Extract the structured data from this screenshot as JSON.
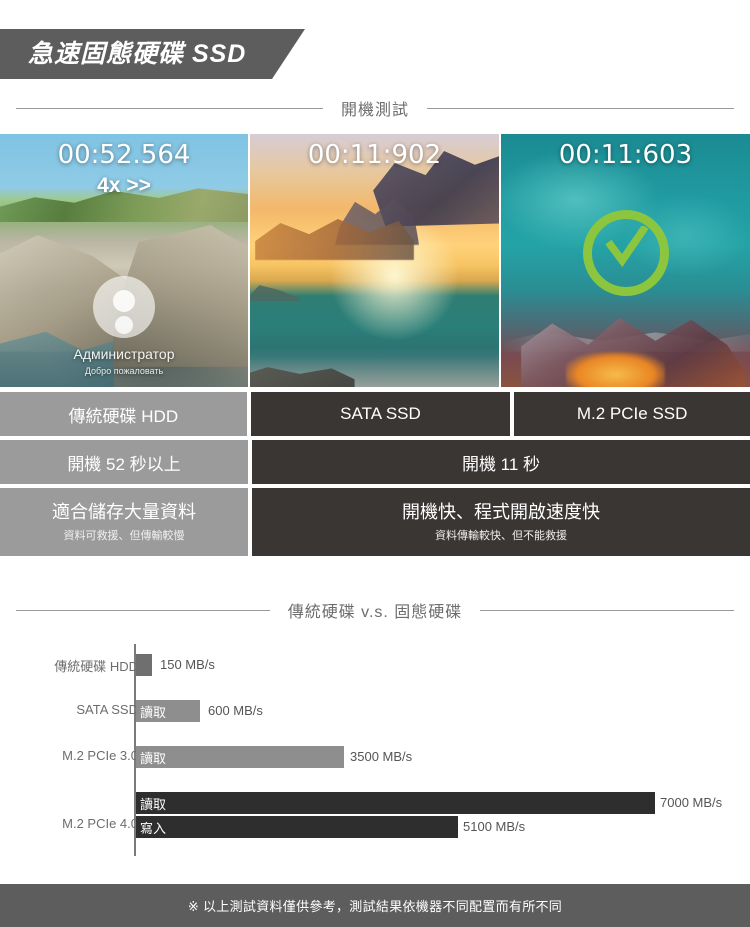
{
  "header": {
    "banner_title": "急速固態硬碟 SSD"
  },
  "sections": {
    "boot_test_title": "開機測試",
    "comparison_title": "傳統硬碟 v.s. 固態硬碟"
  },
  "boot_panels": [
    {
      "timer": "00:52.564",
      "speed_tag": "4x >>",
      "user_name": "Администратор",
      "welcome": "Добро пожаловать",
      "scene": "rocky-coast-windows-logon"
    },
    {
      "timer": "00:11:902",
      "speed_tag": "",
      "scene": "sunset-ocean"
    },
    {
      "timer": "00:11:603",
      "speed_tag": "",
      "scene": "teal-water-check",
      "check_color": "#8cc63f"
    }
  ],
  "table": {
    "row_headers": [
      "傳統硬碟 HDD",
      "SATA SSD",
      "M.2 PCIe SSD"
    ],
    "row_boot": [
      "開機 52 秒以上",
      "開機 11 秒"
    ],
    "row_traits": [
      {
        "main": "適合儲存大量資料",
        "sub": "資料可救援、但傳輸較慢"
      },
      {
        "main": "開機快、程式開啟速度快",
        "sub": "資料傳輸較快、但不能救援"
      }
    ]
  },
  "chart_data": {
    "type": "bar",
    "title": "傳統硬碟 v.s. 固態硬碟",
    "xlabel": "",
    "ylabel": "",
    "unit": "MB/s",
    "orientation": "horizontal",
    "xlim": [
      0,
      7000
    ],
    "grid": false,
    "legend": "none",
    "categories": [
      "傳統硬碟 HDD",
      "SATA SSD",
      "M.2 PCIe 3.0",
      "M.2 PCIe 4.0"
    ],
    "bars": [
      {
        "category": "傳統硬碟 HDD",
        "mode": "",
        "value": 150,
        "label": "150 MB/s",
        "color": "#6f6f6f"
      },
      {
        "category": "SATA SSD",
        "mode": "讀取",
        "value": 600,
        "label": "600 MB/s",
        "color": "#8e8e8e"
      },
      {
        "category": "M.2 PCIe 3.0",
        "mode": "讀取",
        "value": 3500,
        "label": "3500 MB/s",
        "color": "#8e8e8e"
      },
      {
        "category": "M.2 PCIe 4.0",
        "mode": "讀取",
        "value": 7000,
        "label": "7000 MB/s",
        "color": "#2e2e2e"
      },
      {
        "category": "M.2 PCIe 4.0",
        "mode": "寫入",
        "value": 5100,
        "label": "5100 MB/s",
        "color": "#2e2e2e"
      }
    ]
  },
  "footer": {
    "note": "※ 以上測試資料僅供參考，測試結果依機器不同配置而有所不同"
  },
  "colors": {
    "banner_bg": "#5d5d5d",
    "cell_gray": "#9b9b9b",
    "cell_dark": "#3a3634",
    "accent_green": "#8cc63f"
  }
}
